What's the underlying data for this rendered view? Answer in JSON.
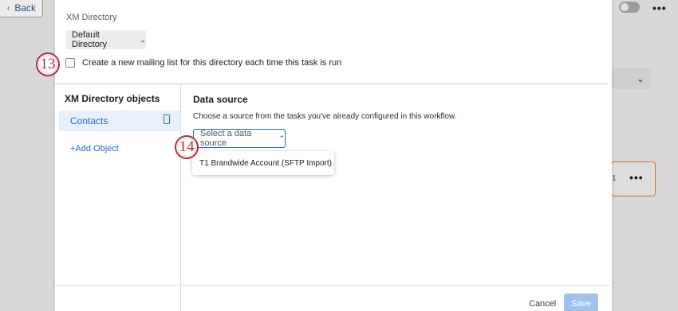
{
  "background": {
    "back_label": "Back",
    "back_icon": "chevron-left-icon",
    "card_number": "1",
    "more_icon": "ellipsis-icon"
  },
  "modal": {
    "xm_directory_label": "XM Directory",
    "directory_select": "Default Directory",
    "mailing_list_checkbox_label": "Create a new mailing list for this directory each time this task is run",
    "mailing_list_checked": false,
    "sidebar": {
      "title": "XM Directory objects",
      "items": [
        {
          "label": "Contacts",
          "selected": true
        }
      ],
      "add_object_label": "+Add Object"
    },
    "data_source": {
      "title": "Data source",
      "description": "Choose a source from the tasks you've already configured in this workflow.",
      "select_placeholder": "Select a data source",
      "options": [
        "T1 Brandwide Account (SFTP Import)"
      ]
    },
    "footer": {
      "cancel_label": "Cancel",
      "save_label": "Save"
    }
  },
  "callouts": [
    "13",
    "14"
  ],
  "colors": {
    "accent": "#1f6bc2",
    "callout": "#b52b34",
    "save_disabled": "#9ec2ea"
  }
}
